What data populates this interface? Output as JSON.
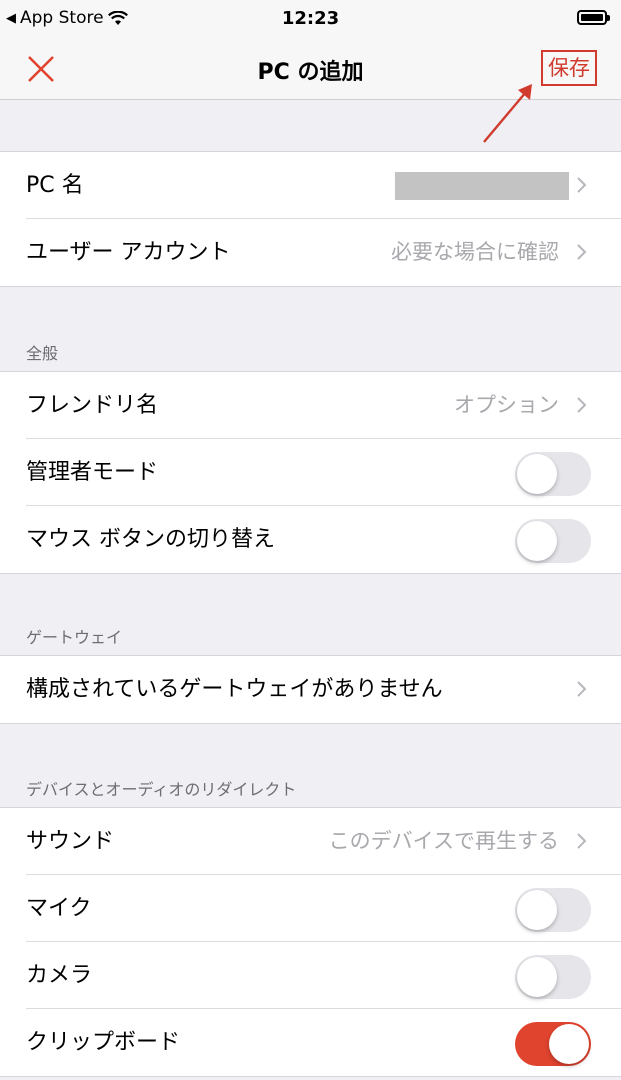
{
  "status": {
    "back_app": "App Store",
    "time": "12:23"
  },
  "nav": {
    "title": "PC の追加",
    "save": "保存"
  },
  "group1": {
    "pc_name_label": "PC 名",
    "user_account_label": "ユーザー アカウント",
    "user_account_value": "必要な場合に確認"
  },
  "general": {
    "header": "全般",
    "friendly_name_label": "フレンドリ名",
    "friendly_name_value": "オプション",
    "admin_mode_label": "管理者モード",
    "admin_mode_on": false,
    "swap_mouse_label": "マウス ボタンの切り替え",
    "swap_mouse_on": false
  },
  "gateway": {
    "header": "ゲートウェイ",
    "none_label": "構成されているゲートウェイがありません"
  },
  "redirect": {
    "header": "デバイスとオーディオのリダイレクト",
    "sound_label": "サウンド",
    "sound_value": "このデバイスで再生する",
    "mic_label": "マイク",
    "mic_on": false,
    "camera_label": "カメラ",
    "camera_on": false,
    "clipboard_label": "クリップボード",
    "clipboard_on": true
  },
  "colors": {
    "accent": "#e0432e",
    "annotation": "#d13b2e"
  }
}
